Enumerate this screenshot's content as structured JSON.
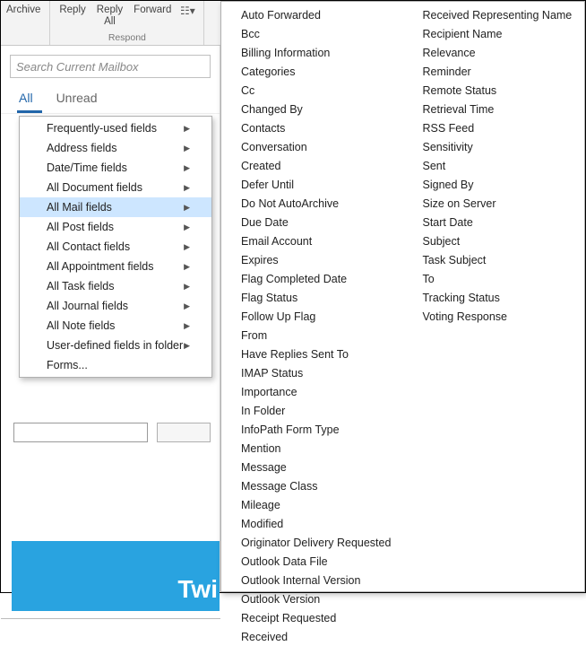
{
  "ribbon": {
    "archive_label": "Archive",
    "reply_label": "Reply",
    "reply_all_label_l1": "Reply",
    "reply_all_label_l2": "All",
    "forward_label": "Forward",
    "respond_group_label": "Respond"
  },
  "search": {
    "placeholder": "Search Current Mailbox"
  },
  "tabs": {
    "all": "All",
    "unread": "Unread"
  },
  "menu1": {
    "items": [
      {
        "label": "Frequently-used fields",
        "has_sub": true
      },
      {
        "label": "Address fields",
        "has_sub": true
      },
      {
        "label": "Date/Time fields",
        "has_sub": true
      },
      {
        "label": "All Document fields",
        "has_sub": true
      },
      {
        "label": "All Mail fields",
        "has_sub": true,
        "selected": true
      },
      {
        "label": "All Post fields",
        "has_sub": true
      },
      {
        "label": "All Contact fields",
        "has_sub": true
      },
      {
        "label": "All Appointment fields",
        "has_sub": true
      },
      {
        "label": "All Task fields",
        "has_sub": true
      },
      {
        "label": "All Journal fields",
        "has_sub": true
      },
      {
        "label": "All Note fields",
        "has_sub": true
      },
      {
        "label": "User-defined fields in folder",
        "has_sub": true
      },
      {
        "label": "Forms...",
        "has_sub": false
      }
    ]
  },
  "menu2": {
    "col1": [
      "Auto Forwarded",
      "Bcc",
      "Billing Information",
      "Categories",
      "Cc",
      "Changed By",
      "Contacts",
      "Conversation",
      "Created",
      "Defer Until",
      "Do Not AutoArchive",
      "Due Date",
      "Email Account",
      "Expires",
      "Flag Completed Date",
      "Flag Status",
      "Follow Up Flag",
      "From",
      "Have Replies Sent To",
      "IMAP Status",
      "Importance",
      "In Folder",
      "InfoPath Form Type",
      "Mention",
      "Message",
      "Message Class",
      "Mileage",
      "Modified",
      "Originator Delivery Requested",
      "Outlook Data File",
      "Outlook Internal Version",
      "Outlook Version",
      "Receipt Requested",
      "Received"
    ],
    "col2": [
      "Received Representing Name",
      "Recipient Name",
      "Relevance",
      "Reminder",
      "Remote Status",
      "Retrieval Time",
      "RSS Feed",
      "Sensitivity",
      "Sent",
      "Signed By",
      "Size on Server",
      "Start Date",
      "Subject",
      "Task Subject",
      "To",
      "Tracking Status",
      "Voting Response"
    ]
  },
  "blue_band_text": "Twi"
}
